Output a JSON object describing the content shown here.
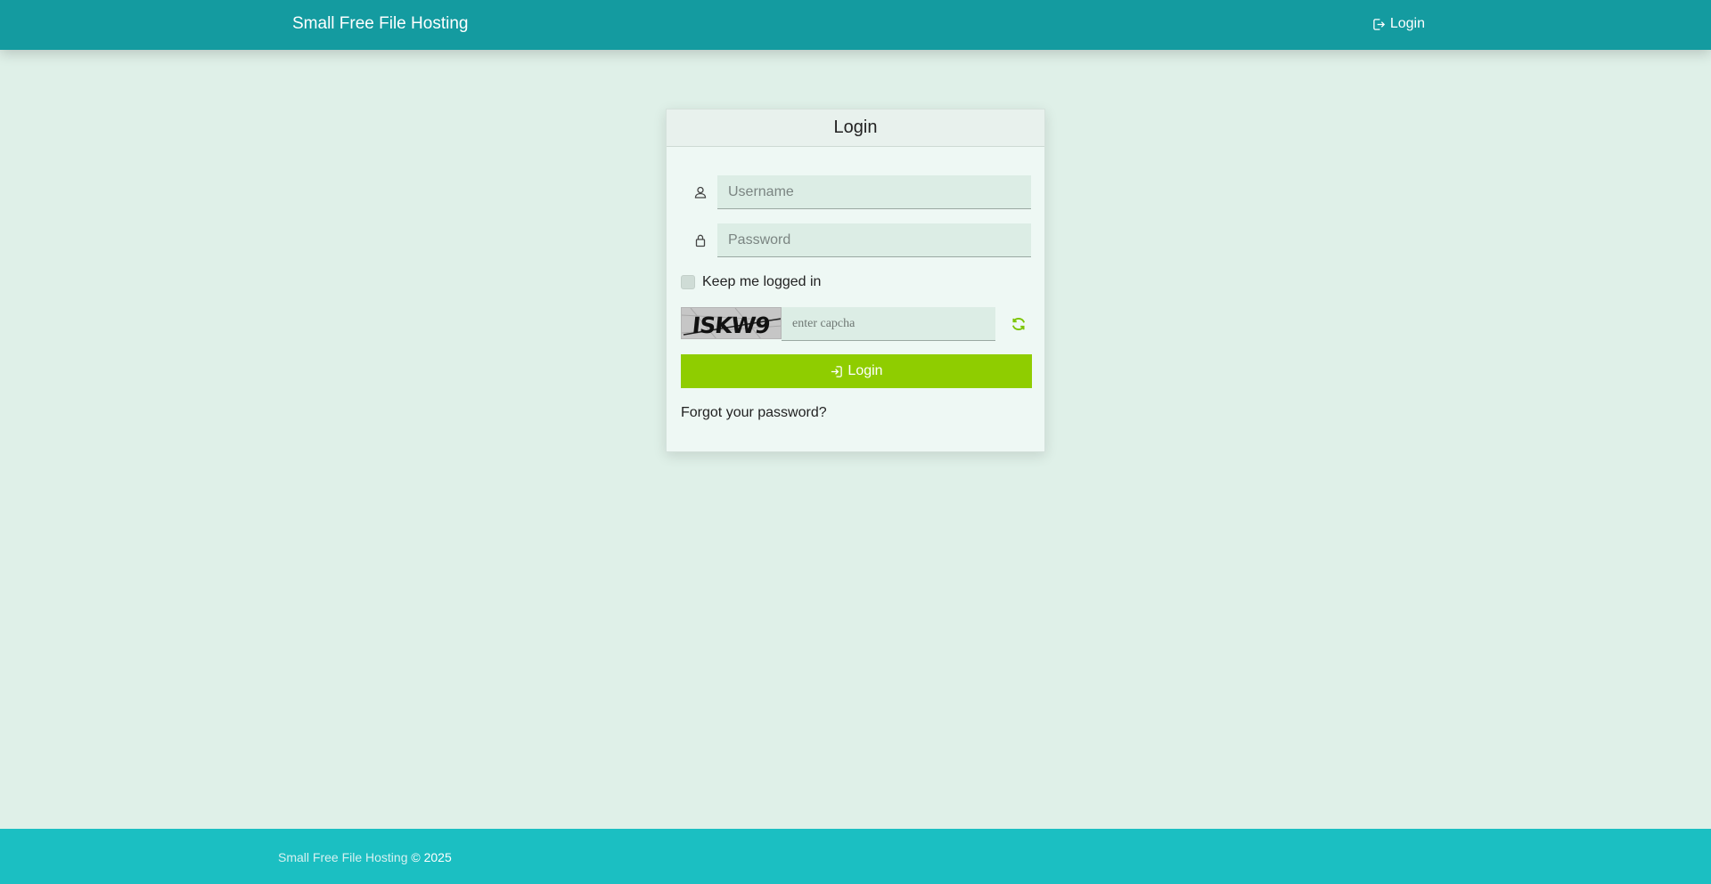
{
  "navbar": {
    "brand": "Small Free File Hosting",
    "login_label": "Login"
  },
  "card": {
    "title": "Login",
    "username_placeholder": "Username",
    "password_placeholder": "Password",
    "remember_label": "Keep me logged in",
    "captcha_text": "ISKW9",
    "captcha_placeholder": "enter capcha",
    "login_button": "Login",
    "forgot_link": "Forgot your password?"
  },
  "footer": {
    "site_link": "Small Free File Hosting",
    "copyright": " © 2025"
  },
  "colors": {
    "navbar": "#149ba0",
    "background": "#dff0e8",
    "button": "#8fcd00",
    "footer": "#1bbfc2",
    "refresh_icon": "#7bc400"
  },
  "icons": {
    "nav_login": "sign-in-icon",
    "username": "user-icon",
    "password": "lock-icon",
    "refresh": "refresh-icon",
    "button": "sign-in-icon"
  }
}
